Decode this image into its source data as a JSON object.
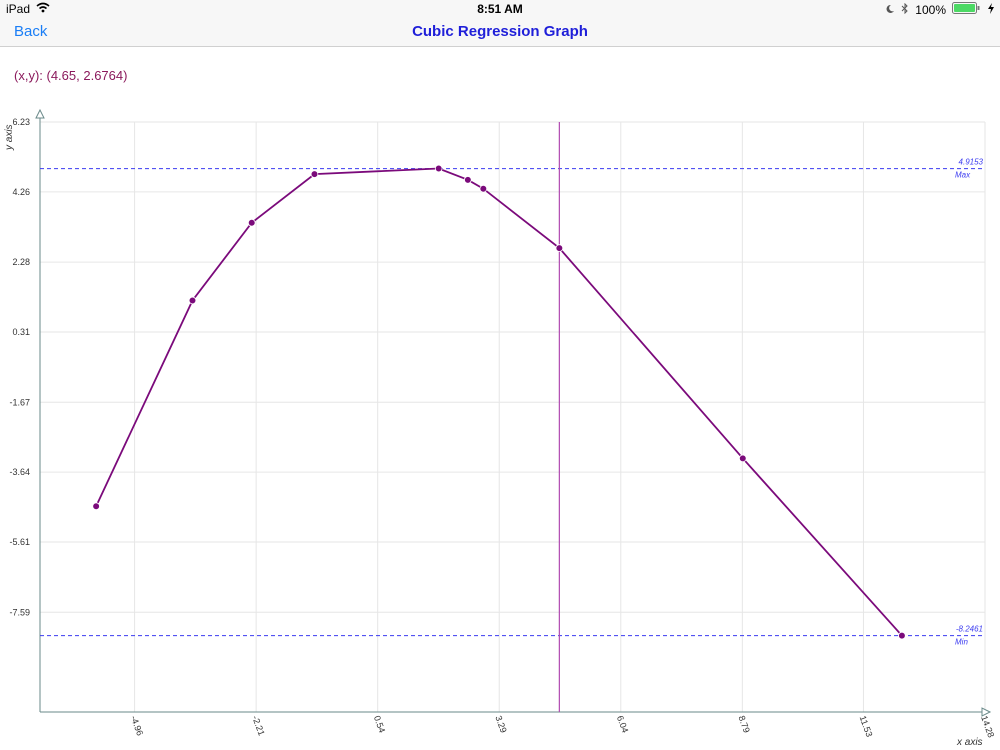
{
  "status_bar": {
    "device": "iPad",
    "time": "8:51 AM",
    "battery": "100%"
  },
  "nav": {
    "back_label": "Back",
    "title": "Cubic Regression Graph"
  },
  "readout": {
    "text": "(x,y): (4.65, 2.6764)"
  },
  "colors": {
    "series": "#7b0a7b",
    "cursor": "#b04ab0",
    "guide": "#3b3bf0",
    "grid": "#e6e6e6",
    "axis": "#6a8a8a"
  },
  "chart_data": {
    "type": "line",
    "xlabel": "x axis",
    "ylabel": "y axis",
    "xlim": [
      -7.1,
      14.28
    ],
    "ylim": [
      -10.4,
      6.23
    ],
    "x_ticks": [
      "-4.96",
      "-2.21",
      "0.54",
      "3.29",
      "6.04",
      "8.79",
      "11.53",
      "14.28"
    ],
    "x_tick_values": [
      -4.96,
      -2.21,
      0.54,
      3.29,
      6.04,
      8.79,
      11.53,
      14.28
    ],
    "y_ticks": [
      "6.23",
      "4.26",
      "2.28",
      "0.31",
      "-1.67",
      "-3.64",
      "-5.61",
      "-7.59"
    ],
    "y_tick_values": [
      6.23,
      4.26,
      2.28,
      0.31,
      -1.67,
      -3.64,
      -5.61,
      -7.59
    ],
    "points": [
      {
        "x": -5.83,
        "y": -4.6
      },
      {
        "x": -3.65,
        "y": 1.2
      },
      {
        "x": -2.31,
        "y": 3.39
      },
      {
        "x": -0.89,
        "y": 4.76
      },
      {
        "x": 1.92,
        "y": 4.92
      },
      {
        "x": 2.58,
        "y": 4.6
      },
      {
        "x": 2.93,
        "y": 4.35
      },
      {
        "x": 4.65,
        "y": 2.6764
      },
      {
        "x": 8.8,
        "y": -3.25
      },
      {
        "x": 12.4,
        "y": -8.2461
      }
    ],
    "max": {
      "value": 4.9153,
      "value_label": "4.9153",
      "label": "Max"
    },
    "min": {
      "value": -8.2461,
      "value_label": "-8.2461",
      "label": "Min"
    },
    "cursor_x": 4.65,
    "grid": true
  }
}
